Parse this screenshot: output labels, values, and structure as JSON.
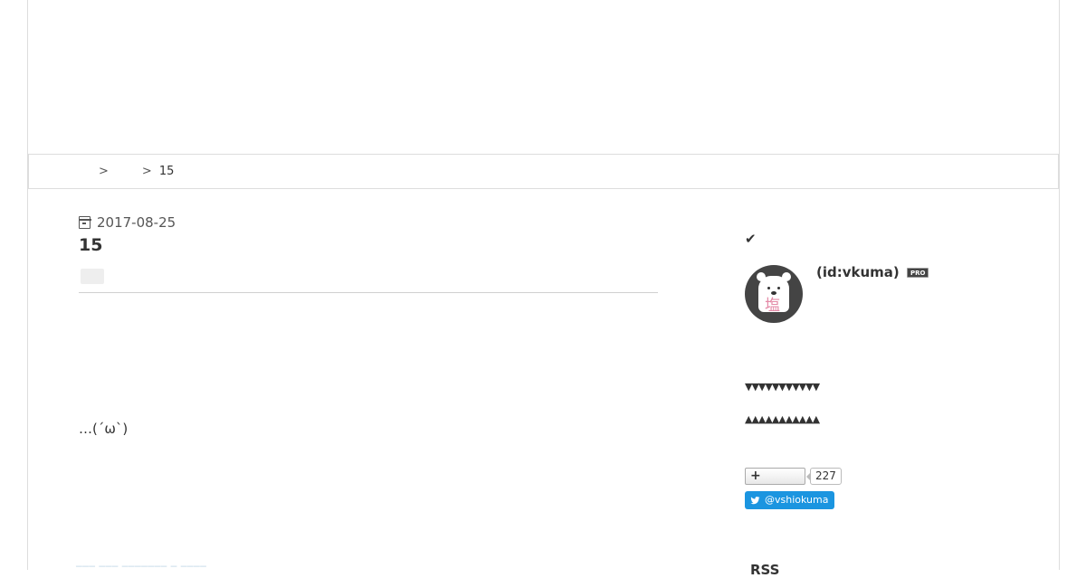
{
  "breadcrumb": {
    "home_label": "",
    "category_label": "",
    "separator": ">",
    "current": "15"
  },
  "entry": {
    "date": "2017-08-25",
    "title": "15",
    "body": "…(´ω`)",
    "footer_faded": "─── ─── ─────── ─ ────"
  },
  "sidebar": {
    "check_icon": "✔",
    "profile_name": "(id:vkuma)",
    "pro_badge": "PRO",
    "avatar_kanji": "塩",
    "toggle_down": "▼▼▼▼▼▼▼▼▼▼▼",
    "toggle_up": "▲▲▲▲▲▲▲▲▲▲▲",
    "follow_count": "227",
    "twitter_handle": "@vshiokuma",
    "rss_heading": "RSS"
  },
  "colors": {
    "link": "#3b8ec2",
    "twitter": "#1b95e0",
    "avatar_bg": "#444444",
    "kanji": "#e48aa7"
  },
  "icons": [
    "calendar-icon",
    "check-icon",
    "plus-icon",
    "twitter-bird-icon",
    "rss-icon"
  ]
}
